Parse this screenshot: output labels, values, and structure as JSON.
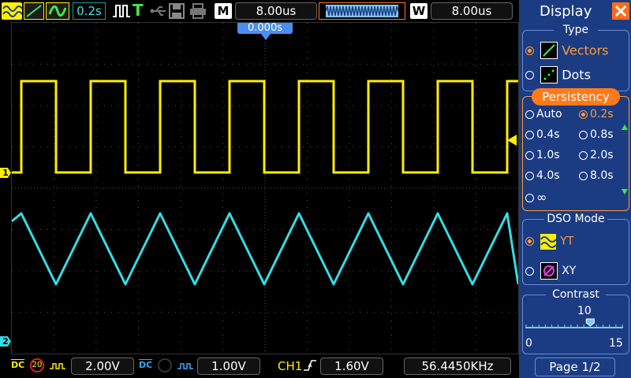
{
  "top_bar": {
    "persistence_time": "0.2s",
    "trigger_status": "T",
    "m_label": "M",
    "timebase": "8.00us",
    "w_label": "W",
    "window_timebase": "8.00us",
    "trigger_position": "0.000s"
  },
  "bottom_bar": {
    "ch1_coupling": "DC",
    "ch1_bw_limit": "20",
    "ch1_scale": "2.00V",
    "ch2_coupling": "DC",
    "ch2_scale": "1.00V",
    "trigger_source": "CH1",
    "trigger_level": "1.60V",
    "frequency": "56.4450KHz"
  },
  "screen": {
    "ch1_marker": "1",
    "ch2_marker": "2",
    "ch1_color": "#ffee00",
    "ch2_color": "#33dde6"
  },
  "panel": {
    "title": "Display",
    "type_label": "Type",
    "type_options": [
      {
        "label": "Vectors",
        "selected": true
      },
      {
        "label": "Dots",
        "selected": false
      }
    ],
    "persistency_label": "Persistency",
    "persistency_options": [
      {
        "label": "Auto",
        "selected": false
      },
      {
        "label": "0.2s",
        "selected": true
      },
      {
        "label": "0.4s",
        "selected": false
      },
      {
        "label": "0.8s",
        "selected": false
      },
      {
        "label": "1.0s",
        "selected": false
      },
      {
        "label": "2.0s",
        "selected": false
      },
      {
        "label": "4.0s",
        "selected": false
      },
      {
        "label": "8.0s",
        "selected": false
      },
      {
        "label": "∞",
        "selected": false
      }
    ],
    "dso_mode_label": "DSO Mode",
    "dso_mode_options": [
      {
        "label": "YT",
        "selected": true
      },
      {
        "label": "XY",
        "selected": false
      }
    ],
    "contrast_label": "Contrast",
    "contrast_value": "10",
    "contrast_min": "0",
    "contrast_max": "15",
    "contrast_level": 10,
    "page_label": "Page 1/2",
    "accent_color": "#ff9a3c",
    "panel_color": "#1b3c82"
  }
}
